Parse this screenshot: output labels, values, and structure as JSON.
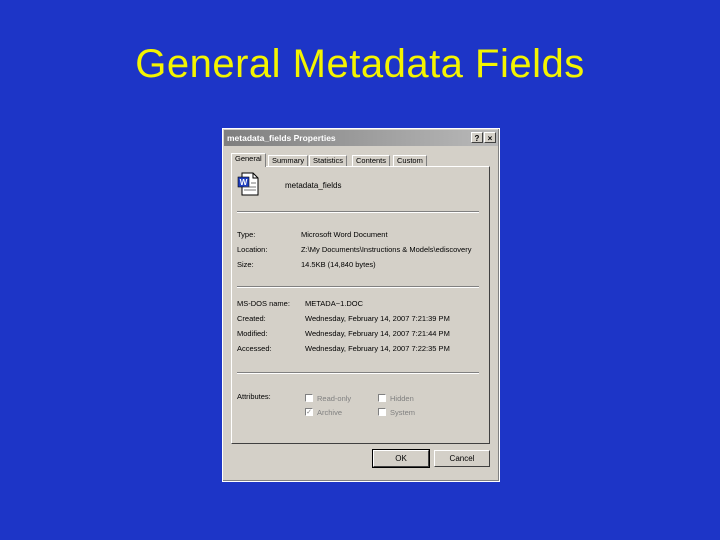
{
  "slide": {
    "title": "General Metadata Fields"
  },
  "dialog": {
    "title": "metadata_fields Properties",
    "help_label": "?",
    "close_label": "×",
    "tabs": [
      {
        "label": "General"
      },
      {
        "label": "Summary"
      },
      {
        "label": "Statistics"
      },
      {
        "label": "Contents"
      },
      {
        "label": "Custom"
      }
    ],
    "file": {
      "name": "metadata_fields",
      "icon": "word-document-icon",
      "icon_glyph": "W"
    },
    "props1": [
      {
        "label": "Type:",
        "value": "Microsoft Word Document"
      },
      {
        "label": "Location:",
        "value": "Z:\\My Documents\\Instructions & Models\\ediscovery"
      },
      {
        "label": "Size:",
        "value": "14.5KB (14,840 bytes)"
      }
    ],
    "props2": [
      {
        "label": "MS-DOS name:",
        "value": "METADA~1.DOC"
      },
      {
        "label": "Created:",
        "value": "Wednesday, February 14, 2007 7:21:39 PM"
      },
      {
        "label": "Modified:",
        "value": "Wednesday, February 14, 2007 7:21:44 PM"
      },
      {
        "label": "Accessed:",
        "value": "Wednesday, February 14, 2007 7:22:35 PM"
      }
    ],
    "attributes": {
      "label": "Attributes:",
      "items": [
        {
          "label": "Read-only",
          "checked": false
        },
        {
          "label": "Hidden",
          "checked": false
        },
        {
          "label": "Archive",
          "checked": true
        },
        {
          "label": "System",
          "checked": false
        }
      ],
      "check_glyph": "✓"
    },
    "buttons": {
      "ok": "OK",
      "cancel": "Cancel"
    }
  }
}
